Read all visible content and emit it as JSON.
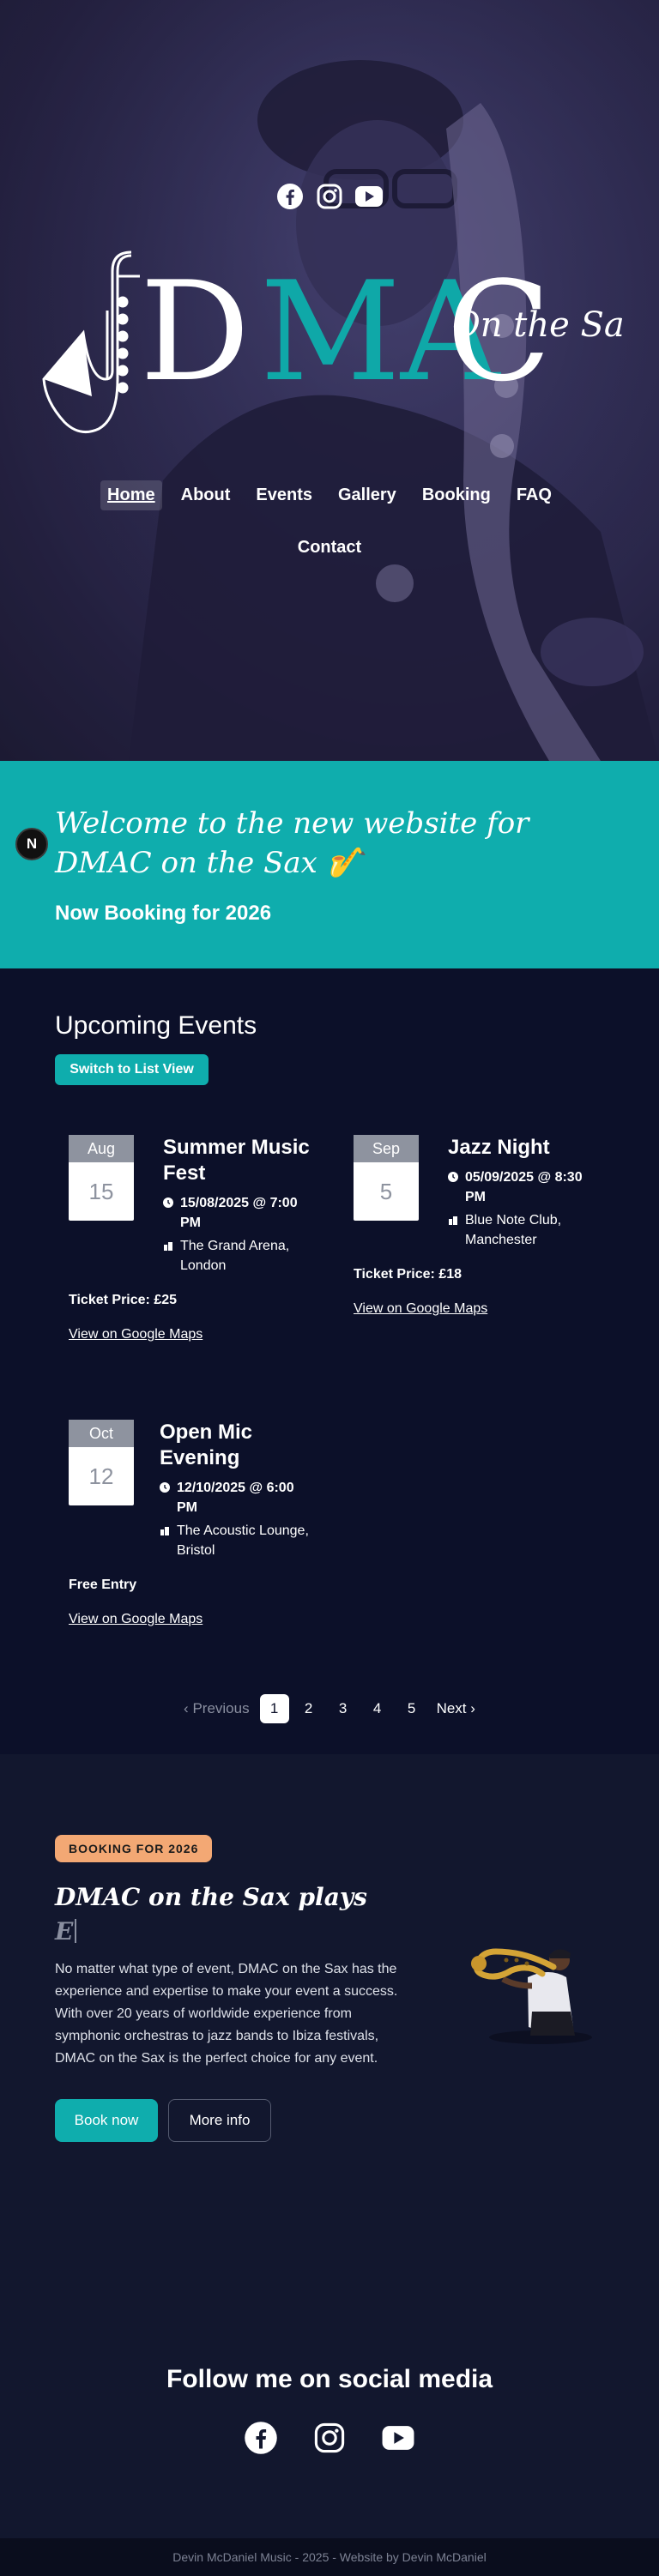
{
  "social_top": {
    "icons": [
      "facebook-icon",
      "instagram-icon",
      "youtube-icon"
    ]
  },
  "logo": {
    "letters_white_1": "D",
    "letters_teal": "MA",
    "letters_white_2": "C",
    "subtitle": "On the Sax",
    "teal_color": "#0fa8a8"
  },
  "nav": {
    "row1": [
      "Home",
      "About",
      "Events",
      "Gallery",
      "Booking",
      "FAQ"
    ],
    "row2": [
      "Contact"
    ],
    "active": "Home"
  },
  "welcome": {
    "heading": "Welcome to the new website for DMAC on the Sax 🎷",
    "subheading": "Now Booking for 2026",
    "badge": "N",
    "bg_color": "#0fadad"
  },
  "events": {
    "title": "Upcoming Events",
    "switch_label": "Switch to List View",
    "items": [
      {
        "month": "Aug",
        "day": "15",
        "title": "Summer Music Fest",
        "datetime": "15/08/2025 @ 7:00 PM",
        "venue": "The Grand Arena, London",
        "price": "Ticket Price: £25",
        "maps": "View on Google Maps"
      },
      {
        "month": "Sep",
        "day": "5",
        "title": "Jazz Night",
        "datetime": "05/09/2025 @ 8:30 PM",
        "venue": "Blue Note Club, Manchester",
        "price": "Ticket Price: £18",
        "maps": "View on Google Maps"
      },
      {
        "month": "Oct",
        "day": "12",
        "title": "Open Mic Evening",
        "datetime": "12/10/2025 @ 6:00 PM",
        "venue": "The Acoustic Lounge, Bristol",
        "price": "Free Entry",
        "maps": "View on Google Maps"
      }
    ],
    "pagination": {
      "previous": "Previous",
      "pages": [
        "1",
        "2",
        "3",
        "4",
        "5"
      ],
      "current": "1",
      "next": "Next"
    }
  },
  "booking": {
    "pill": "BOOKING FOR 2026",
    "title": "DMAC on the Sax plays",
    "typed": "E",
    "text": "No matter what type of event, DMAC on the Sax has the experience and expertise to make your event a success. With over 20 years of worldwide experience from symphonic orchestras to jazz bands to Ibiza festivals, DMAC on the Sax is the perfect choice for any event.",
    "book_label": "Book now",
    "info_label": "More info",
    "pill_color": "#f3a874"
  },
  "follow": {
    "title": "Follow me on social media",
    "icons": [
      "facebook-icon",
      "instagram-icon",
      "youtube-icon"
    ]
  },
  "footer": {
    "text": "Devin McDaniel Music - 2025 - Website by Devin McDaniel"
  }
}
